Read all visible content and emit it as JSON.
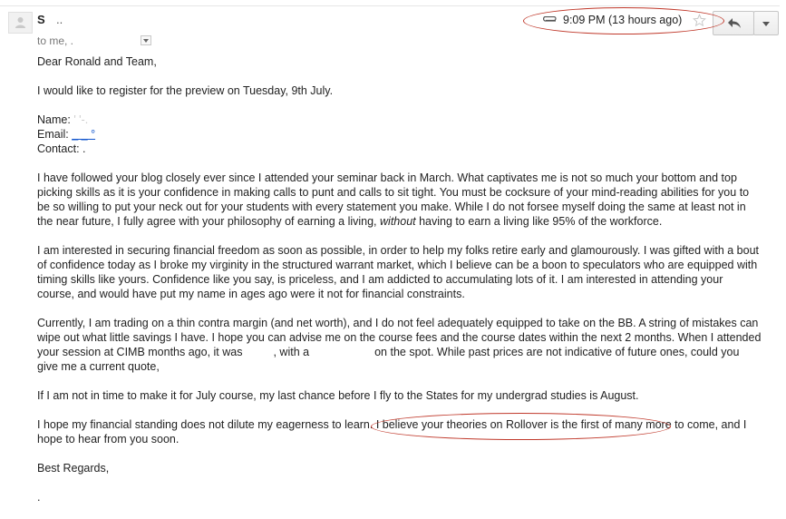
{
  "header": {
    "sender_name": "S",
    "sender_rest": "..",
    "to_line": "to me, .",
    "timestamp": "9:09 PM (13 hours ago)",
    "icons": [
      "person-icon",
      "paperclip-icon",
      "star-icon",
      "reply-icon",
      "chevron-down-icon"
    ]
  },
  "body": {
    "greeting": "Dear Ronald and Team,",
    "intro": "I would like to register for the preview on Tuesday, 9th July.",
    "fields": {
      "name_label": "Name:",
      "name_value": "' '-.",
      "email_label": "Email:",
      "email_value": "_ _ °",
      "contact_label": "Contact:",
      "contact_value": "."
    },
    "para1_a": "I have followed your blog closely ever since I attended your seminar back in March. What captivates me is not so much your bottom and top picking skills as it is your confidence in making calls to punt and calls to sit tight. You must be cocksure of your mind-reading abilities for you to be so willing to put your neck out for your students with every statement you make. While I do not forsee myself doing the same at least not in the near future, I fully agree with your philosophy of earning a living,",
    "para1_em": "without",
    "para1_b": "having to earn a living like 95% of the workforce.",
    "para2": "I am interested in securing financial freedom as soon as possible, in order to help my folks retire early and glamourously. I was gifted with a bout of confidence today as I broke my virginity in the structured warrant market, which I believe can be a boon to speculators who are equipped with timing skills like yours. Confidence like you say, is priceless, and I am addicted to accumulating lots of it. I am interested in attending your course, and would have put my name in ages ago were it not for financial constraints.",
    "para3_a": "Currently, I am trading on a thin contra margin (and net worth), and I do not feel adequately equipped to take on the BB. A string of mistakes can wipe out what little savings I have. I hope you can advise me on the course fees and the course dates within the next 2 months. When I attended your session at CIMB months ago, it was",
    "para3_b": ", with a",
    "para3_c": "on the spot. While past prices are not indicative of future ones, could you give me a current quote,",
    "para4": "If I am not in time to make it for July course, my last chance before I fly to the States for my undergrad studies is August.",
    "para5": "I hope my financial standing does not dilute my eagerness to learn. I believe your theories on Rollover is the first of many more to come, and I hope to hear from you soon.",
    "closing": "Best Regards,",
    "signature": "."
  },
  "colors": {
    "annotation_oval": "#c0392b",
    "link": "#1155cc"
  }
}
